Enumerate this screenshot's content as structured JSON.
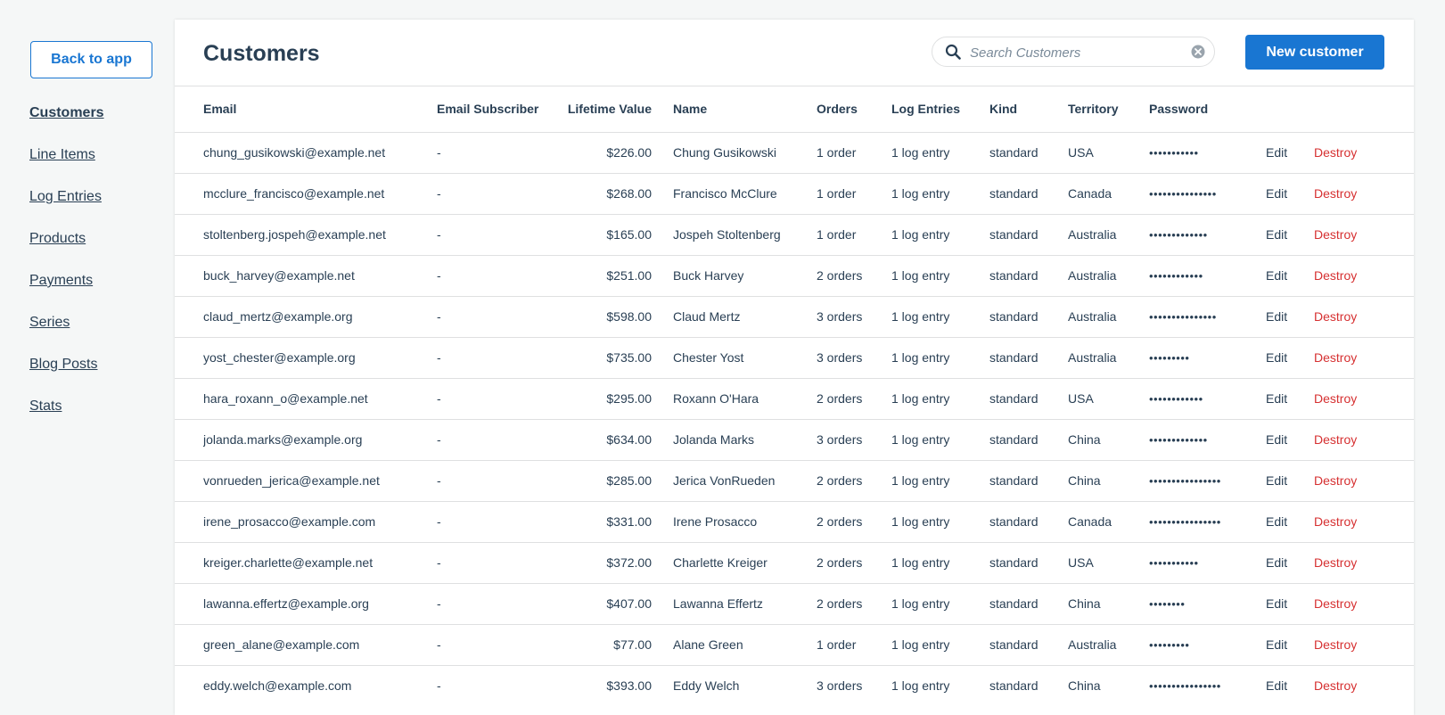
{
  "sidebar": {
    "back_label": "Back to app",
    "items": [
      {
        "label": "Customers",
        "active": true
      },
      {
        "label": "Line Items"
      },
      {
        "label": "Log Entries"
      },
      {
        "label": "Products"
      },
      {
        "label": "Payments"
      },
      {
        "label": "Series"
      },
      {
        "label": "Blog Posts"
      },
      {
        "label": "Stats"
      }
    ]
  },
  "header": {
    "title": "Customers",
    "search_placeholder": "Search Customers",
    "new_button_label": "New customer"
  },
  "table": {
    "columns": [
      "Email",
      "Email Subscriber",
      "Lifetime Value",
      "Name",
      "Orders",
      "Log Entries",
      "Kind",
      "Territory",
      "Password"
    ],
    "edit_label": "Edit",
    "destroy_label": "Destroy",
    "rows": [
      {
        "email": "chung_gusikowski@example.net",
        "subscriber": "-",
        "lifetime_value": "$226.00",
        "name": "Chung Gusikowski",
        "orders": "1 order",
        "log_entries": "1 log entry",
        "kind": "standard",
        "territory": "USA",
        "password": "•••••••••••"
      },
      {
        "email": "mcclure_francisco@example.net",
        "subscriber": "-",
        "lifetime_value": "$268.00",
        "name": "Francisco McClure",
        "orders": "1 order",
        "log_entries": "1 log entry",
        "kind": "standard",
        "territory": "Canada",
        "password": "•••••••••••••••"
      },
      {
        "email": "stoltenberg.jospeh@example.net",
        "subscriber": "-",
        "lifetime_value": "$165.00",
        "name": "Jospeh Stoltenberg",
        "orders": "1 order",
        "log_entries": "1 log entry",
        "kind": "standard",
        "territory": "Australia",
        "password": "•••••••••••••"
      },
      {
        "email": "buck_harvey@example.net",
        "subscriber": "-",
        "lifetime_value": "$251.00",
        "name": "Buck Harvey",
        "orders": "2 orders",
        "log_entries": "1 log entry",
        "kind": "standard",
        "territory": "Australia",
        "password": "••••••••••••"
      },
      {
        "email": "claud_mertz@example.org",
        "subscriber": "-",
        "lifetime_value": "$598.00",
        "name": "Claud Mertz",
        "orders": "3 orders",
        "log_entries": "1 log entry",
        "kind": "standard",
        "territory": "Australia",
        "password": "•••••••••••••••"
      },
      {
        "email": "yost_chester@example.org",
        "subscriber": "-",
        "lifetime_value": "$735.00",
        "name": "Chester Yost",
        "orders": "3 orders",
        "log_entries": "1 log entry",
        "kind": "standard",
        "territory": "Australia",
        "password": "•••••••••"
      },
      {
        "email": "hara_roxann_o@example.net",
        "subscriber": "-",
        "lifetime_value": "$295.00",
        "name": "Roxann O'Hara",
        "orders": "2 orders",
        "log_entries": "1 log entry",
        "kind": "standard",
        "territory": "USA",
        "password": "••••••••••••"
      },
      {
        "email": "jolanda.marks@example.org",
        "subscriber": "-",
        "lifetime_value": "$634.00",
        "name": "Jolanda Marks",
        "orders": "3 orders",
        "log_entries": "1 log entry",
        "kind": "standard",
        "territory": "China",
        "password": "•••••••••••••"
      },
      {
        "email": "vonrueden_jerica@example.net",
        "subscriber": "-",
        "lifetime_value": "$285.00",
        "name": "Jerica VonRueden",
        "orders": "2 orders",
        "log_entries": "1 log entry",
        "kind": "standard",
        "territory": "China",
        "password": "••••••••••••••••"
      },
      {
        "email": "irene_prosacco@example.com",
        "subscriber": "-",
        "lifetime_value": "$331.00",
        "name": "Irene Prosacco",
        "orders": "2 orders",
        "log_entries": "1 log entry",
        "kind": "standard",
        "territory": "Canada",
        "password": "••••••••••••••••"
      },
      {
        "email": "kreiger.charlette@example.net",
        "subscriber": "-",
        "lifetime_value": "$372.00",
        "name": "Charlette Kreiger",
        "orders": "2 orders",
        "log_entries": "1 log entry",
        "kind": "standard",
        "territory": "USA",
        "password": "•••••••••••"
      },
      {
        "email": "lawanna.effertz@example.org",
        "subscriber": "-",
        "lifetime_value": "$407.00",
        "name": "Lawanna Effertz",
        "orders": "2 orders",
        "log_entries": "1 log entry",
        "kind": "standard",
        "territory": "China",
        "password": "••••••••"
      },
      {
        "email": "green_alane@example.com",
        "subscriber": "-",
        "lifetime_value": "$77.00",
        "name": "Alane Green",
        "orders": "1 order",
        "log_entries": "1 log entry",
        "kind": "standard",
        "territory": "Australia",
        "password": "•••••••••"
      },
      {
        "email": "eddy.welch@example.com",
        "subscriber": "-",
        "lifetime_value": "$393.00",
        "name": "Eddy Welch",
        "orders": "3 orders",
        "log_entries": "1 log entry",
        "kind": "standard",
        "territory": "China",
        "password": "••••••••••••••••"
      }
    ]
  }
}
